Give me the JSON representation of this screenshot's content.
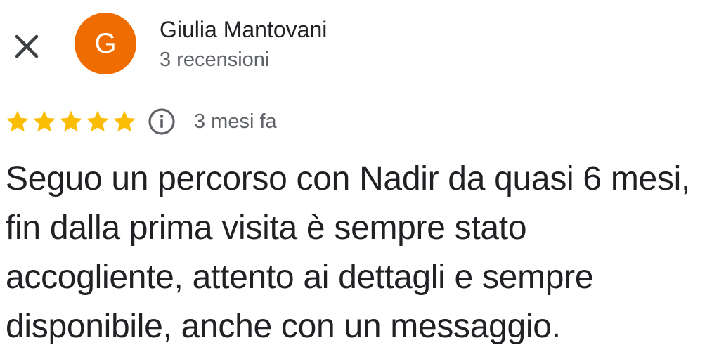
{
  "header": {
    "close_icon": "close-icon",
    "avatar": {
      "initial": "G",
      "color": "#ef6c00"
    },
    "author_name": "Giulia Mantovani",
    "review_count": "3 recensioni"
  },
  "rating": {
    "stars": 5,
    "max_stars": 5,
    "star_color": "#fbbc04",
    "info_icon": "info-icon",
    "date": "3 mesi fa"
  },
  "review": {
    "text": "Seguo un percorso con Nadir da quasi 6 mesi, fin dalla prima visita è sempre stato accogliente, attento ai dettagli e sempre disponibile, anche con un messaggio."
  }
}
